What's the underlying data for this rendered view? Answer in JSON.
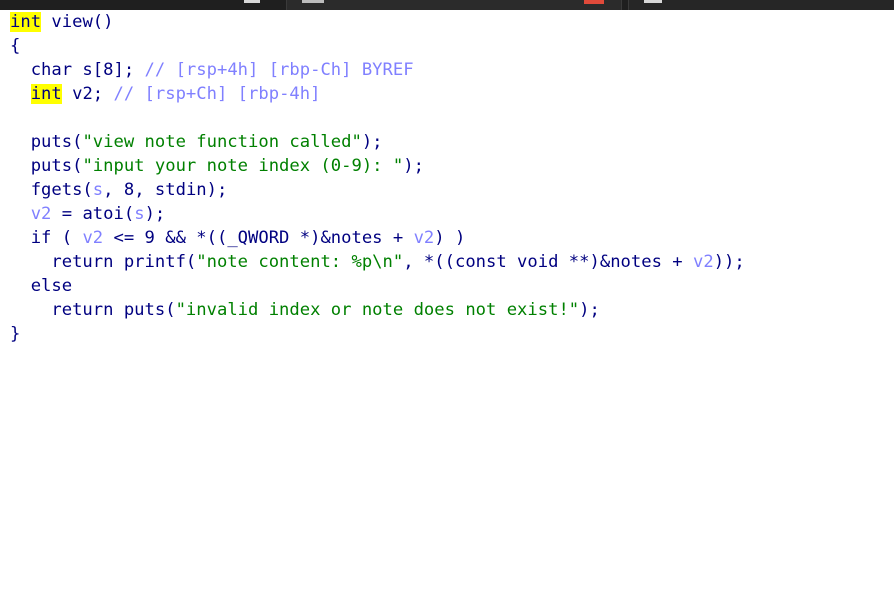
{
  "editor": {
    "lines": {
      "l1": {
        "kw": "int",
        "rest": " view()"
      },
      "l2": {
        "brace": "{"
      },
      "l3": {
        "decl": "  char s[8]; ",
        "cmt": "// [rsp+4h] [rbp-Ch] BYREF"
      },
      "l4": {
        "kw": "int",
        "var": " v2; ",
        "cmt": "// [rsp+Ch] [rbp-4h]"
      },
      "l6": {
        "a": "  puts(",
        "s": "\"view note function called\"",
        "b": ");"
      },
      "l7": {
        "a": "  puts(",
        "s": "\"input your note index (0-9): \"",
        "b": ");"
      },
      "l8": {
        "a": "  fgets(",
        "v1": "s",
        "b": ", 8, stdin);"
      },
      "l9": {
        "v1": "  v2",
        "a": " = atoi(",
        "v2": "s",
        "b": ");"
      },
      "l10": {
        "a": "  if ( ",
        "v1": "v2",
        "b": " <= 9 && *((_QWORD *)&notes + ",
        "v2": "v2",
        "c": ") )"
      },
      "l11": {
        "a": "    return printf(",
        "s": "\"note content: %p\\n\"",
        "b": ", *((const void **)&notes + ",
        "v1": "v2",
        "c": "));"
      },
      "l12": {
        "a": "  else"
      },
      "l13": {
        "a": "    return puts(",
        "s": "\"invalid index or note does not exist!\"",
        "b": ");"
      },
      "l14": {
        "brace": "}"
      }
    }
  }
}
